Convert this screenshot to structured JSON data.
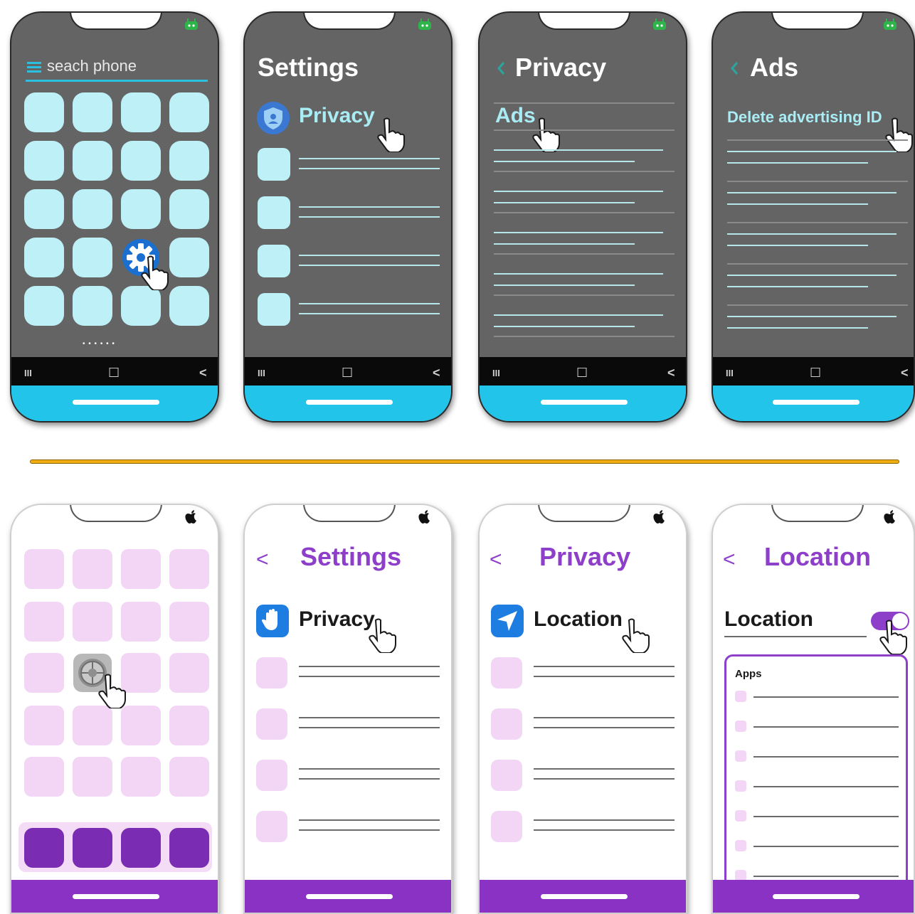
{
  "colors": {
    "android_bg": "#646464",
    "android_accent": "#23c4ea",
    "android_tile": "#bdf1f7",
    "ios_accent": "#8a32c4",
    "ios_tile": "#f3d6f6",
    "divider": "#f0ac10"
  },
  "android": {
    "os_icon": "android-icon",
    "nav": {
      "recents": "III",
      "home": "☐",
      "back": "<"
    },
    "screens": [
      {
        "search_placeholder": "seach phone",
        "page_dots": "• • • • • •"
      },
      {
        "title": "Settings",
        "item": "Privacy",
        "item_icon": "shield-icon"
      },
      {
        "title": "Privacy",
        "item": "Ads"
      },
      {
        "title": "Ads",
        "item": "Delete advertising ID"
      }
    ]
  },
  "ios": {
    "os_icon": "apple-icon",
    "screens": [
      {
        "app_icon": "gear-icon"
      },
      {
        "back": "<",
        "title": "Settings",
        "item": "Privacy",
        "item_icon": "hand-icon"
      },
      {
        "back": "<",
        "title": "Privacy",
        "item": "Location",
        "item_icon": "location-arrow-icon"
      },
      {
        "back": "<",
        "title": "Location",
        "item": "Location",
        "toggle": "on",
        "box_label": "Apps"
      }
    ]
  }
}
